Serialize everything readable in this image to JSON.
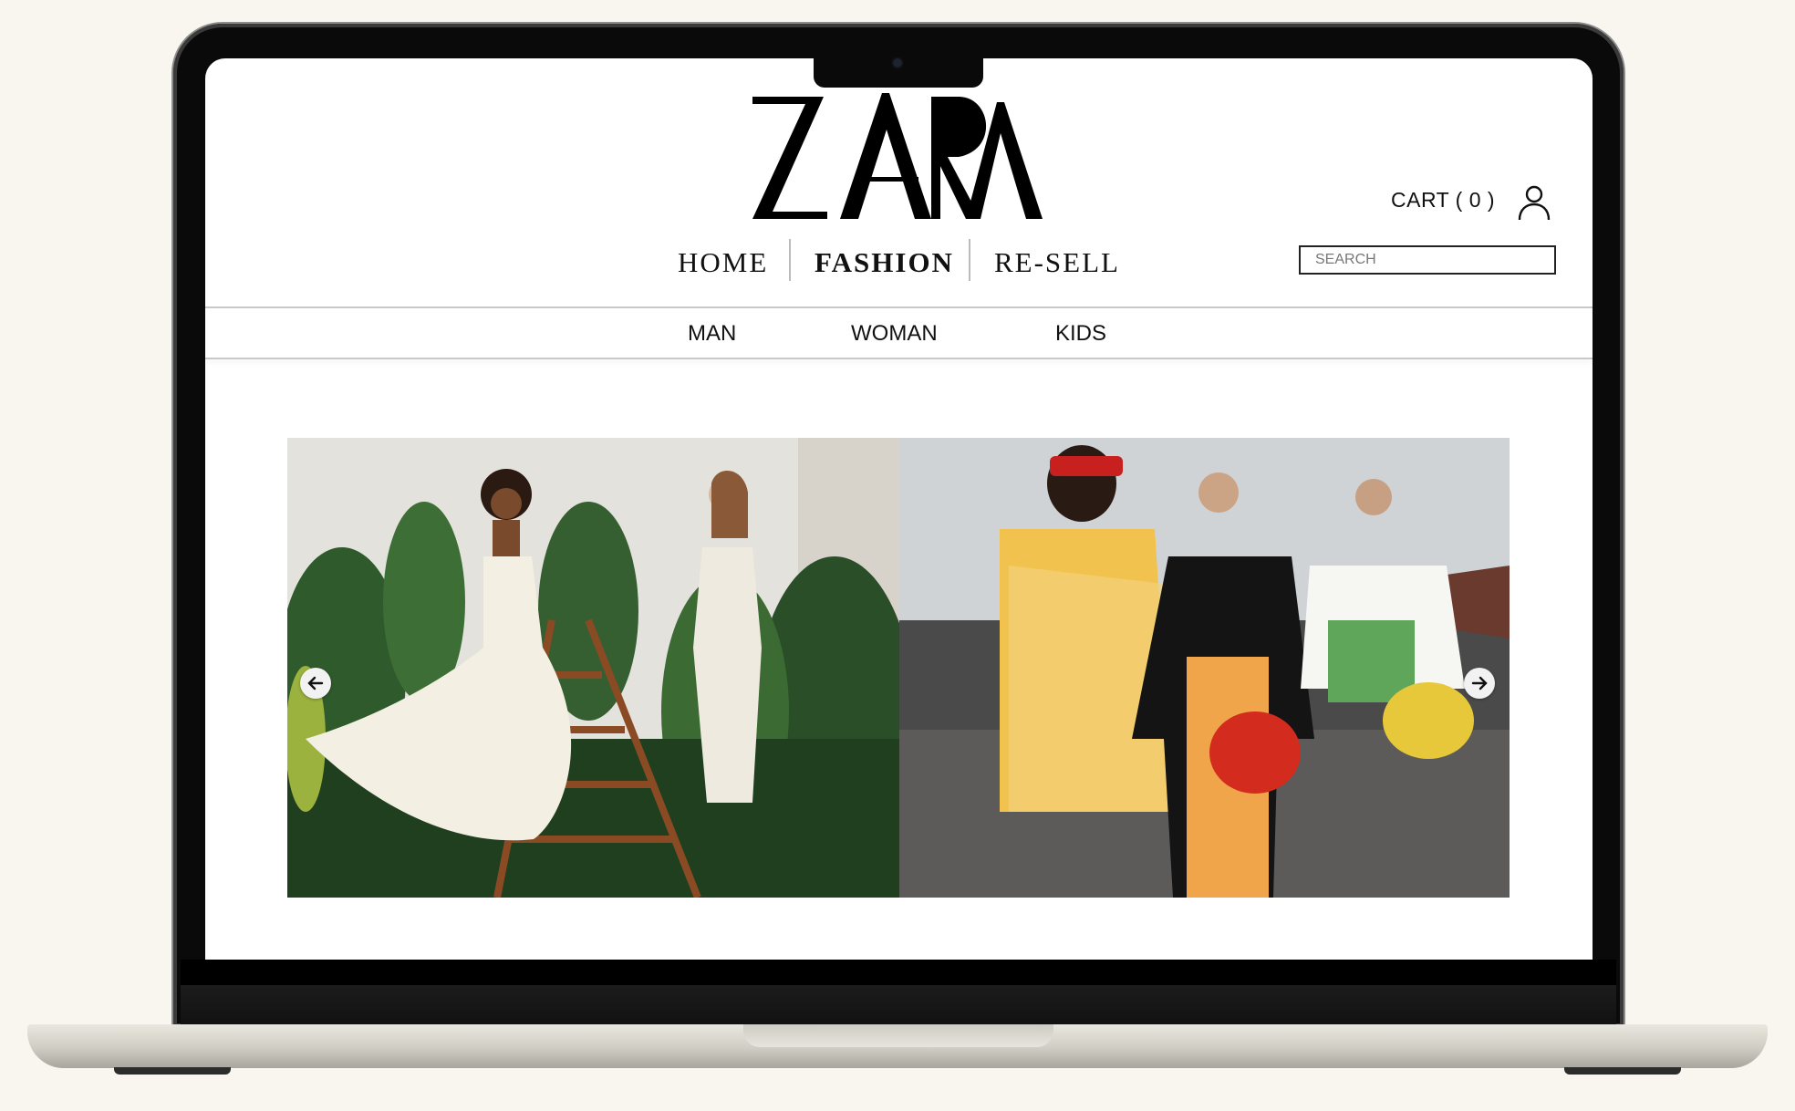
{
  "brand": {
    "logo_text": "ZARA"
  },
  "header": {
    "cart_label": "CART ( 0 )"
  },
  "nav": {
    "home": "HOME",
    "fashion": "FASHION",
    "resell": "RE-SELL"
  },
  "search": {
    "placeholder": "SEARCH"
  },
  "subnav": {
    "man": "MAN",
    "woman": "WOMAN",
    "kids": "KIDS"
  },
  "carousel": {
    "prev_icon": "arrow-left-icon",
    "next_icon": "arrow-right-icon"
  },
  "colors": {
    "page_bg": "#f8f6ee",
    "text": "#111111",
    "accent": "#000000"
  }
}
